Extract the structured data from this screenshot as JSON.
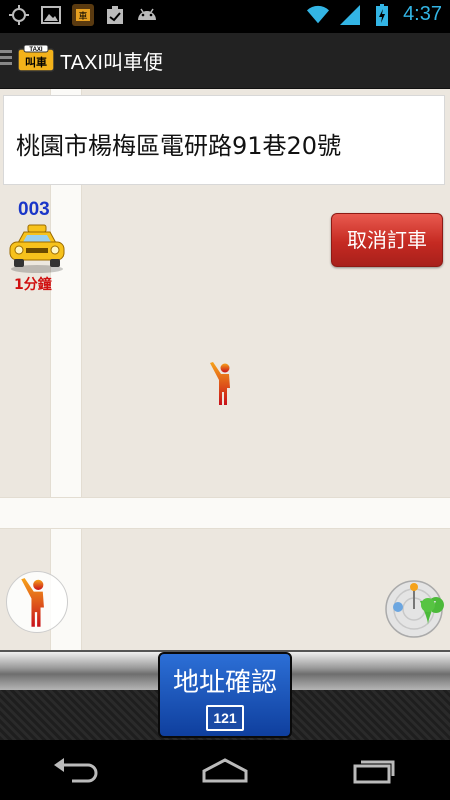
{
  "status_bar": {
    "time": "4:37",
    "icons_left": [
      "gps-icon",
      "image-icon",
      "app-notification-icon",
      "task-icon",
      "android-icon"
    ],
    "icons_right": [
      "wifi-icon",
      "signal-icon",
      "battery-icon"
    ]
  },
  "action_bar": {
    "title": "TAXI叫車便"
  },
  "map": {
    "address": "桃園市楊梅區電研路91巷20號",
    "taxi": {
      "number": "003",
      "eta": "1分鐘"
    },
    "cancel_button": "取消訂車"
  },
  "bottom": {
    "confirm_button": "地址確認",
    "badge": "121"
  },
  "colors": {
    "accent": "#33b5e5",
    "taxi_number": "#1a36c8",
    "eta": "#d01010",
    "cancel_red": "#c52a22",
    "confirm_blue": "#1a4aa5"
  }
}
